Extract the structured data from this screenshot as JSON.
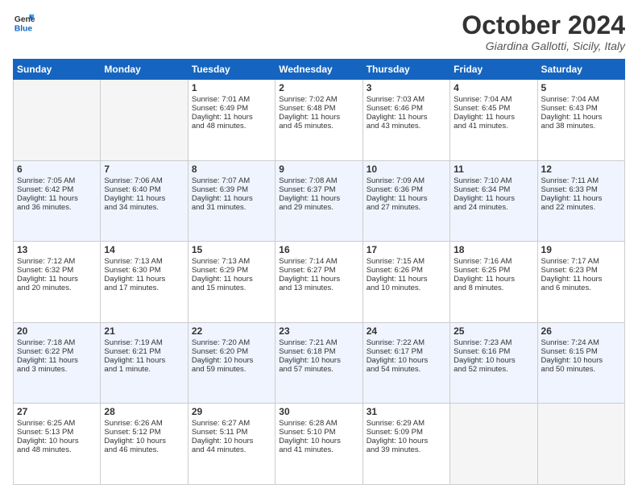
{
  "logo": {
    "line1": "General",
    "line2": "Blue"
  },
  "header": {
    "month": "October 2024",
    "location": "Giardina Gallotti, Sicily, Italy"
  },
  "weekdays": [
    "Sunday",
    "Monday",
    "Tuesday",
    "Wednesday",
    "Thursday",
    "Friday",
    "Saturday"
  ],
  "weeks": [
    [
      {
        "day": "",
        "info": ""
      },
      {
        "day": "",
        "info": ""
      },
      {
        "day": "1",
        "info": "Sunrise: 7:01 AM\nSunset: 6:49 PM\nDaylight: 11 hours\nand 48 minutes."
      },
      {
        "day": "2",
        "info": "Sunrise: 7:02 AM\nSunset: 6:48 PM\nDaylight: 11 hours\nand 45 minutes."
      },
      {
        "day": "3",
        "info": "Sunrise: 7:03 AM\nSunset: 6:46 PM\nDaylight: 11 hours\nand 43 minutes."
      },
      {
        "day": "4",
        "info": "Sunrise: 7:04 AM\nSunset: 6:45 PM\nDaylight: 11 hours\nand 41 minutes."
      },
      {
        "day": "5",
        "info": "Sunrise: 7:04 AM\nSunset: 6:43 PM\nDaylight: 11 hours\nand 38 minutes."
      }
    ],
    [
      {
        "day": "6",
        "info": "Sunrise: 7:05 AM\nSunset: 6:42 PM\nDaylight: 11 hours\nand 36 minutes."
      },
      {
        "day": "7",
        "info": "Sunrise: 7:06 AM\nSunset: 6:40 PM\nDaylight: 11 hours\nand 34 minutes."
      },
      {
        "day": "8",
        "info": "Sunrise: 7:07 AM\nSunset: 6:39 PM\nDaylight: 11 hours\nand 31 minutes."
      },
      {
        "day": "9",
        "info": "Sunrise: 7:08 AM\nSunset: 6:37 PM\nDaylight: 11 hours\nand 29 minutes."
      },
      {
        "day": "10",
        "info": "Sunrise: 7:09 AM\nSunset: 6:36 PM\nDaylight: 11 hours\nand 27 minutes."
      },
      {
        "day": "11",
        "info": "Sunrise: 7:10 AM\nSunset: 6:34 PM\nDaylight: 11 hours\nand 24 minutes."
      },
      {
        "day": "12",
        "info": "Sunrise: 7:11 AM\nSunset: 6:33 PM\nDaylight: 11 hours\nand 22 minutes."
      }
    ],
    [
      {
        "day": "13",
        "info": "Sunrise: 7:12 AM\nSunset: 6:32 PM\nDaylight: 11 hours\nand 20 minutes."
      },
      {
        "day": "14",
        "info": "Sunrise: 7:13 AM\nSunset: 6:30 PM\nDaylight: 11 hours\nand 17 minutes."
      },
      {
        "day": "15",
        "info": "Sunrise: 7:13 AM\nSunset: 6:29 PM\nDaylight: 11 hours\nand 15 minutes."
      },
      {
        "day": "16",
        "info": "Sunrise: 7:14 AM\nSunset: 6:27 PM\nDaylight: 11 hours\nand 13 minutes."
      },
      {
        "day": "17",
        "info": "Sunrise: 7:15 AM\nSunset: 6:26 PM\nDaylight: 11 hours\nand 10 minutes."
      },
      {
        "day": "18",
        "info": "Sunrise: 7:16 AM\nSunset: 6:25 PM\nDaylight: 11 hours\nand 8 minutes."
      },
      {
        "day": "19",
        "info": "Sunrise: 7:17 AM\nSunset: 6:23 PM\nDaylight: 11 hours\nand 6 minutes."
      }
    ],
    [
      {
        "day": "20",
        "info": "Sunrise: 7:18 AM\nSunset: 6:22 PM\nDaylight: 11 hours\nand 3 minutes."
      },
      {
        "day": "21",
        "info": "Sunrise: 7:19 AM\nSunset: 6:21 PM\nDaylight: 11 hours\nand 1 minute."
      },
      {
        "day": "22",
        "info": "Sunrise: 7:20 AM\nSunset: 6:20 PM\nDaylight: 10 hours\nand 59 minutes."
      },
      {
        "day": "23",
        "info": "Sunrise: 7:21 AM\nSunset: 6:18 PM\nDaylight: 10 hours\nand 57 minutes."
      },
      {
        "day": "24",
        "info": "Sunrise: 7:22 AM\nSunset: 6:17 PM\nDaylight: 10 hours\nand 54 minutes."
      },
      {
        "day": "25",
        "info": "Sunrise: 7:23 AM\nSunset: 6:16 PM\nDaylight: 10 hours\nand 52 minutes."
      },
      {
        "day": "26",
        "info": "Sunrise: 7:24 AM\nSunset: 6:15 PM\nDaylight: 10 hours\nand 50 minutes."
      }
    ],
    [
      {
        "day": "27",
        "info": "Sunrise: 6:25 AM\nSunset: 5:13 PM\nDaylight: 10 hours\nand 48 minutes."
      },
      {
        "day": "28",
        "info": "Sunrise: 6:26 AM\nSunset: 5:12 PM\nDaylight: 10 hours\nand 46 minutes."
      },
      {
        "day": "29",
        "info": "Sunrise: 6:27 AM\nSunset: 5:11 PM\nDaylight: 10 hours\nand 44 minutes."
      },
      {
        "day": "30",
        "info": "Sunrise: 6:28 AM\nSunset: 5:10 PM\nDaylight: 10 hours\nand 41 minutes."
      },
      {
        "day": "31",
        "info": "Sunrise: 6:29 AM\nSunset: 5:09 PM\nDaylight: 10 hours\nand 39 minutes."
      },
      {
        "day": "",
        "info": ""
      },
      {
        "day": "",
        "info": ""
      }
    ]
  ]
}
